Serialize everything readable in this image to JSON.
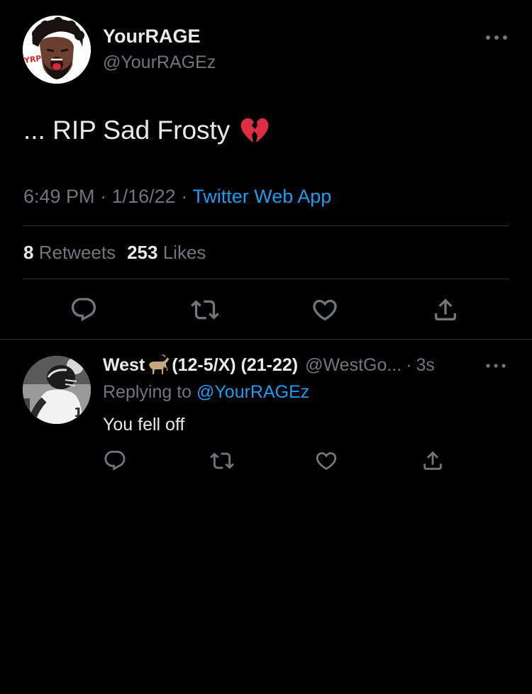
{
  "tweet": {
    "author": {
      "display_name": "YourRAGE",
      "handle": "@YourRAGEz",
      "avatar_icon": "cartoon-avatar-icon"
    },
    "text": "... RIP Sad Frosty",
    "emoji": "broken-heart-icon",
    "time": "6:49 PM",
    "date": "1/16/22",
    "source": "Twitter Web App",
    "stats": {
      "retweets_count": "8",
      "retweets_label": "Retweets",
      "likes_count": "253",
      "likes_label": "Likes"
    },
    "actions": [
      "reply-icon",
      "retweet-icon",
      "like-icon",
      "share-icon"
    ]
  },
  "reply": {
    "author": {
      "display_name": "West",
      "name_emoji": "goat-icon",
      "name_suffix": "(12-5/X) (21-22)",
      "handle": "@WestGo...",
      "avatar_icon": "football-player-avatar-icon"
    },
    "time": "3s",
    "replying_label": "Replying to",
    "replying_to": "@YourRAGEz",
    "text": "You fell off",
    "actions": [
      "reply-icon",
      "retweet-icon",
      "like-icon",
      "share-icon"
    ]
  },
  "colors": {
    "background": "#000000",
    "primary_text": "#e7e9ea",
    "secondary_text": "#71767b",
    "link": "#1d9bf0",
    "divider": "#2f3336"
  }
}
